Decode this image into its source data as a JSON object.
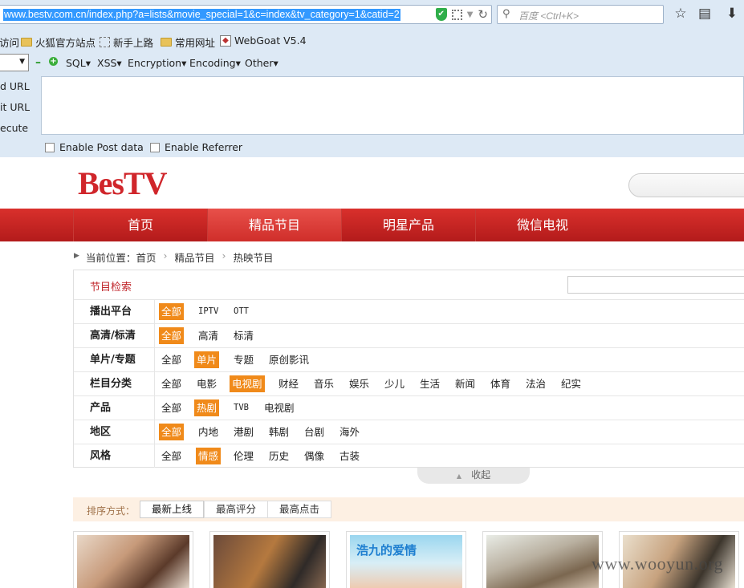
{
  "browser": {
    "url": "www.bestv.com.cn/index.php?a=lists&movie_special=1&c=index&tv_category=1&catid=2",
    "search_placeholder": "百度 <Ctrl+K>",
    "bookmarks": [
      "访问",
      "火狐官方站点",
      "新手上路",
      "常用网址",
      "WebGoat V5.4"
    ]
  },
  "hackbar": {
    "menus": [
      "SQL▾",
      "XSS▾",
      "Encryption▾",
      "Encoding▾",
      "Other▾"
    ],
    "actions": [
      "d URL",
      "it URL",
      "ecute"
    ],
    "checkboxes": [
      "Enable Post data",
      "Enable Referrer"
    ]
  },
  "site": {
    "logo": "BesTV",
    "nav": [
      "首页",
      "精品节目",
      "明星产品",
      "微信电视"
    ],
    "breadcrumb": {
      "prefix": "当前位置：",
      "items": [
        "首页",
        "精品节目",
        "热映节目"
      ]
    },
    "filter_title": "节目检索",
    "filters": [
      {
        "label": "播出平台",
        "options": [
          "全部",
          "IPTV",
          "OTT"
        ],
        "selected": 0
      },
      {
        "label": "高清/标清",
        "options": [
          "全部",
          "高清",
          "标清"
        ],
        "selected": 0
      },
      {
        "label": "单片/专题",
        "options": [
          "全部",
          "单片",
          "专题",
          "原创影讯"
        ],
        "selected": 1
      },
      {
        "label": "栏目分类",
        "options": [
          "全部",
          "电影",
          "电视剧",
          "财经",
          "音乐",
          "娱乐",
          "少儿",
          "生活",
          "新闻",
          "体育",
          "法治",
          "纪实"
        ],
        "selected": 2
      },
      {
        "label": "产品",
        "options": [
          "全部",
          "热剧",
          "TVB",
          "电视剧"
        ],
        "selected": 1
      },
      {
        "label": "地区",
        "options": [
          "全部",
          "内地",
          "港剧",
          "韩剧",
          "台剧",
          "海外"
        ],
        "selected": 0
      },
      {
        "label": "风格",
        "options": [
          "全部",
          "情感",
          "伦理",
          "历史",
          "偶像",
          "古装"
        ],
        "selected": 1
      }
    ],
    "collapse": "收起",
    "sort": {
      "label": "排序方式：",
      "options": [
        "最新上线",
        "最高评分",
        "最高点击"
      ]
    },
    "poster_text": "浩九的爱情",
    "watermark": "www.wooyun.org"
  },
  "colors": {
    "brand_red": "#c8201f",
    "selected_orange": "#f08a1a",
    "url_highlight": "#3399ff"
  }
}
